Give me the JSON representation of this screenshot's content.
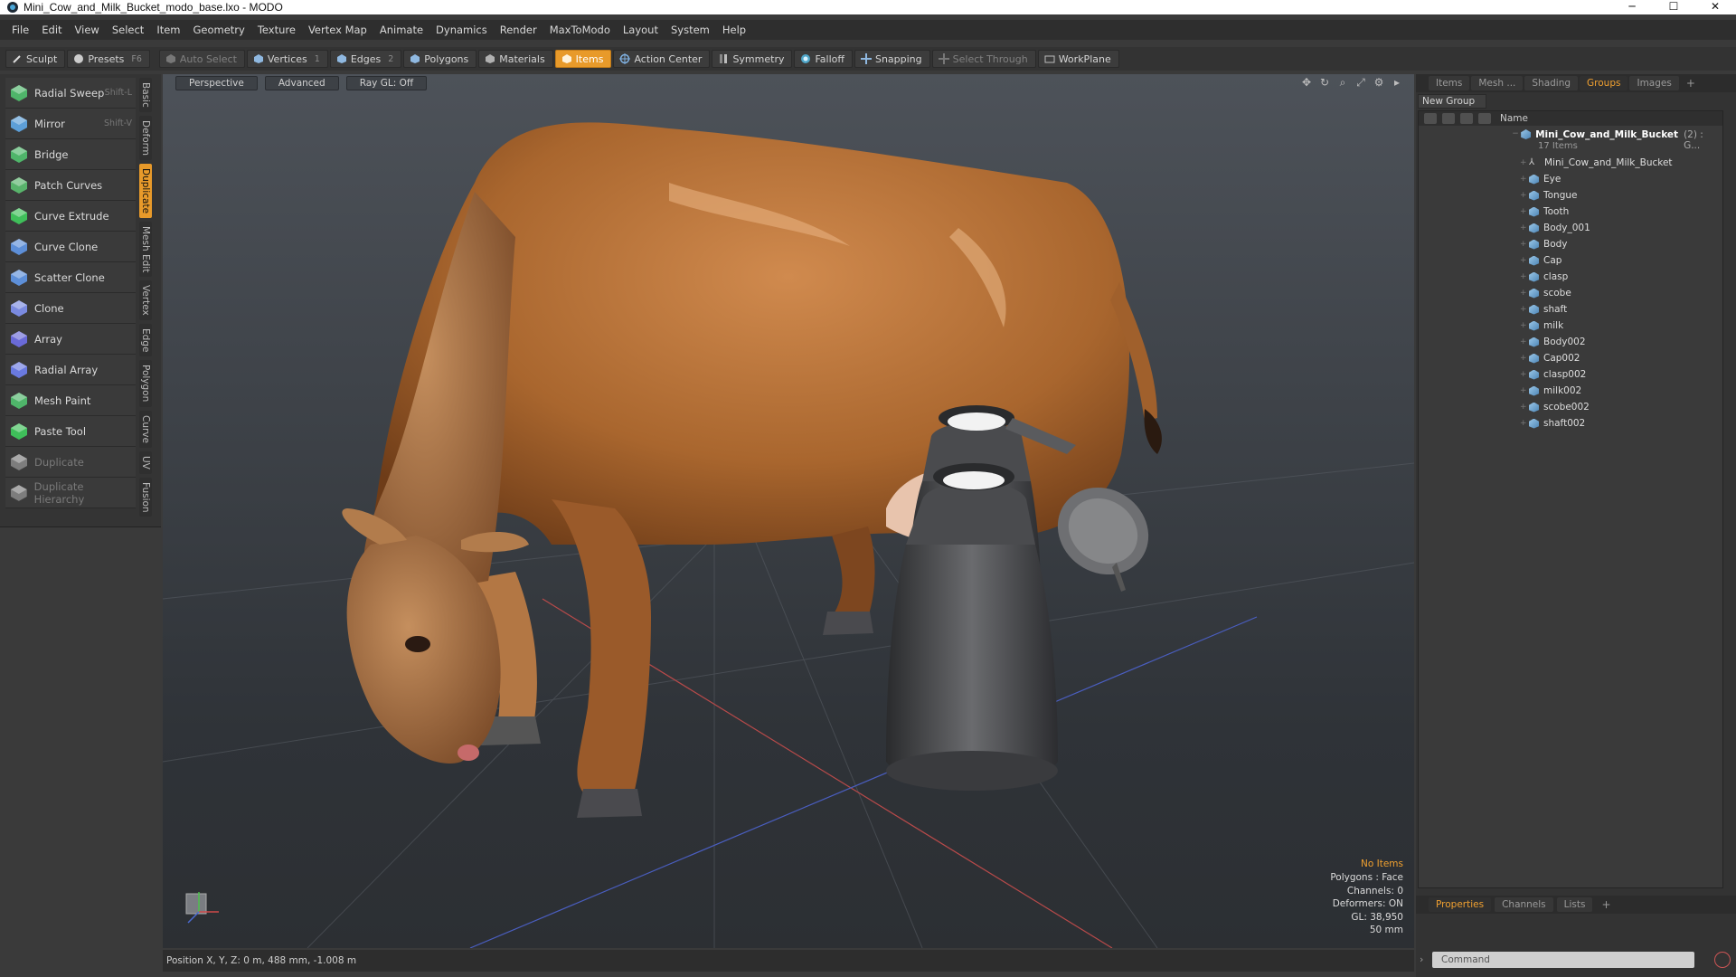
{
  "window": {
    "title": "Mini_Cow_and_Milk_Bucket_modo_base.lxo - MODO",
    "minimize": "─",
    "maximize": "☐",
    "close": "✕"
  },
  "menu": [
    "File",
    "Edit",
    "View",
    "Select",
    "Item",
    "Geometry",
    "Texture",
    "Vertex Map",
    "Animate",
    "Dynamics",
    "Render",
    "MaxToModo",
    "Layout",
    "System",
    "Help"
  ],
  "toolbar": {
    "sculpt": "Sculpt",
    "presets": "Presets",
    "presets_key": "F6",
    "auto_select": "Auto Select",
    "vertices": "Vertices",
    "vertices_key": "1",
    "edges": "Edges",
    "edges_key": "2",
    "polygons": "Polygons",
    "materials": "Materials",
    "items": "Items",
    "action_center": "Action Center",
    "symmetry": "Symmetry",
    "falloff": "Falloff",
    "snapping": "Snapping",
    "select_through": "Select Through",
    "workplane": "WorkPlane"
  },
  "tools": [
    {
      "label": "Radial Sweep",
      "shortcut": "Shift-L",
      "color": "#4fb56a"
    },
    {
      "label": "Mirror",
      "shortcut": "Shift-V",
      "color": "#5d9fd8"
    },
    {
      "label": "Bridge",
      "shortcut": "",
      "color": "#4fb56a"
    },
    {
      "label": "Patch Curves",
      "shortcut": "",
      "color": "#58b36b"
    },
    {
      "label": "Curve Extrude",
      "shortcut": "",
      "color": "#3fbf5a"
    },
    {
      "label": "Curve Clone",
      "shortcut": "",
      "color": "#5d8fd8"
    },
    {
      "label": "Scatter Clone",
      "shortcut": "",
      "color": "#5d8fd8"
    },
    {
      "label": "Clone",
      "shortcut": "",
      "color": "#7a8ae0"
    },
    {
      "label": "Array",
      "shortcut": "",
      "color": "#6a6ad8"
    },
    {
      "label": "Radial Array",
      "shortcut": "",
      "color": "#6a7ae0"
    },
    {
      "label": "Mesh Paint",
      "shortcut": "",
      "color": "#4fb56a"
    },
    {
      "label": "Paste Tool",
      "shortcut": "",
      "color": "#3fbf5a"
    },
    {
      "label": "Duplicate",
      "shortcut": "",
      "color": "#7d7d7d"
    },
    {
      "label": "Duplicate Hierarchy",
      "shortcut": "",
      "color": "#7d7d7d"
    }
  ],
  "vertical_tabs": [
    "Basic",
    "Deform",
    "Duplicate",
    "Mesh Edit",
    "Vertex",
    "Edge",
    "Polygon",
    "Curve",
    "UV",
    "Fusion"
  ],
  "viewport": {
    "view": "Perspective",
    "mode": "Advanced",
    "raygl": "Ray GL: Off",
    "info": {
      "no_items": "No Items",
      "polygons": "Polygons : Face",
      "channels": "Channels: 0",
      "deformers": "Deformers: ON",
      "gl": "GL: 38,950",
      "focal": "50 mm"
    }
  },
  "status": {
    "position": "Position X, Y, Z:  0 m, 488 mm, -1.008 m"
  },
  "right_panel": {
    "tabs": [
      "Items",
      "Mesh ...",
      "Shading",
      "Groups",
      "Images"
    ],
    "plus": "+",
    "new_group": "New Group",
    "column_name": "Name",
    "root": {
      "label": "Mini_Cow_and_Milk_Bucket",
      "extra": "(2) : G...",
      "count": "17 Items"
    },
    "items": [
      "Mini_Cow_and_Milk_Bucket",
      "Eye",
      "Tongue",
      "Tooth",
      "Body_001",
      "Body",
      "Cap",
      "clasp",
      "scobe",
      "shaft",
      "milk",
      "Body002",
      "Cap002",
      "clasp002",
      "milk002",
      "scobe002",
      "shaft002"
    ],
    "bottom_tabs": [
      "Properties",
      "Channels",
      "Lists"
    ],
    "command_placeholder": "Command"
  },
  "colors": {
    "accent": "#e89a2a",
    "cow": "#b7713a",
    "bucket": "#3b3c3f"
  }
}
